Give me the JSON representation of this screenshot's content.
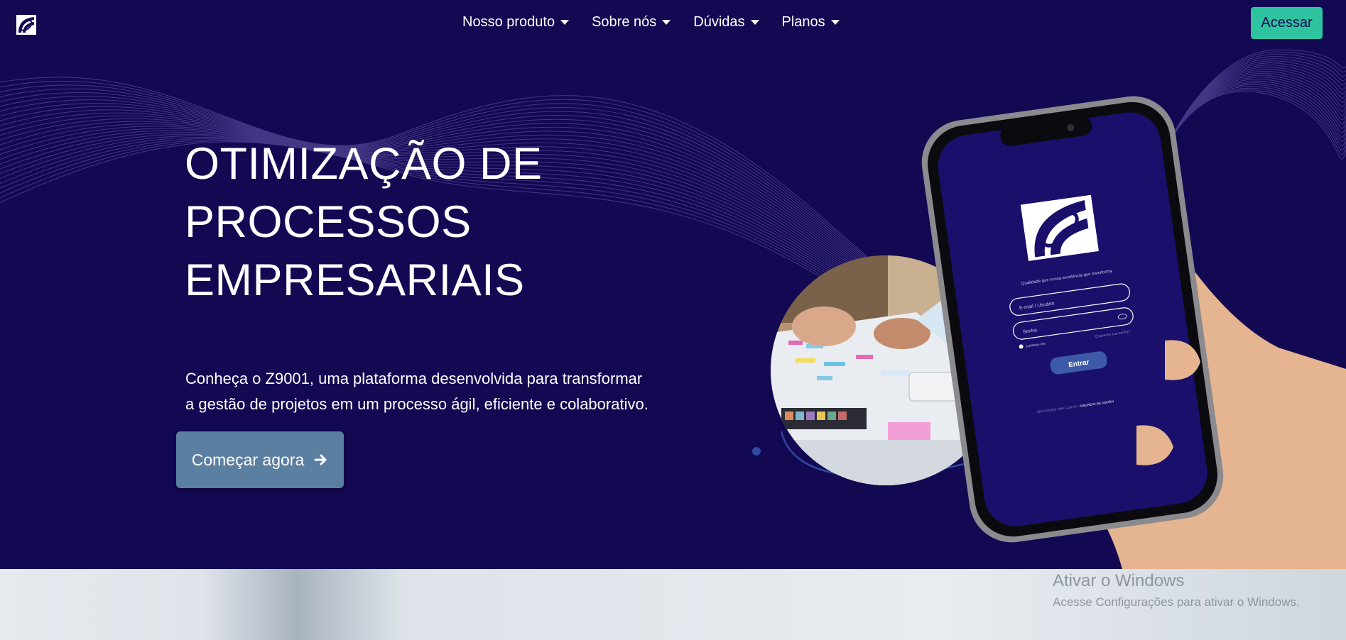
{
  "nav": {
    "logo_icon": "z9001-logo-icon",
    "menu": [
      {
        "label": "Nosso produto"
      },
      {
        "label": "Sobre nós"
      },
      {
        "label": "Dúvidas"
      },
      {
        "label": "Planos"
      }
    ],
    "login_label": "Acessar"
  },
  "hero": {
    "title_lines": [
      "OTIMIZAÇÃO DE",
      "PROCESSOS",
      "EMPRESARIAIS"
    ],
    "subtitle_lines": [
      "Conheça o Z9001, uma plataforma desenvolvida para transformar",
      "a gestão de projetos em um processo ágil, eficiente e colaborativo."
    ],
    "cta_label": "Começar agora",
    "cta_icon": "arrow-right-icon"
  },
  "phone": {
    "tagline": "Qualidade que nossa excelência que transforma",
    "email_placeholder": "E-mail / Usuário",
    "password_placeholder": "Senha",
    "forgot_label": "Esqueceu sua senha?",
    "remember_label": "Lembrar-me",
    "enter_label": "Entrar",
    "signup_prompt": "NÃO POSSUI UMA CONTA?",
    "signup_link": "INSCREVA-SE AGORA!"
  },
  "watermark": {
    "title": "Ativar o Windows",
    "subtitle": "Acesse Configurações para ativar o Windows."
  },
  "colors": {
    "background": "#130852",
    "accent": "#2ec4a0",
    "cta": "#5b7fa0"
  }
}
